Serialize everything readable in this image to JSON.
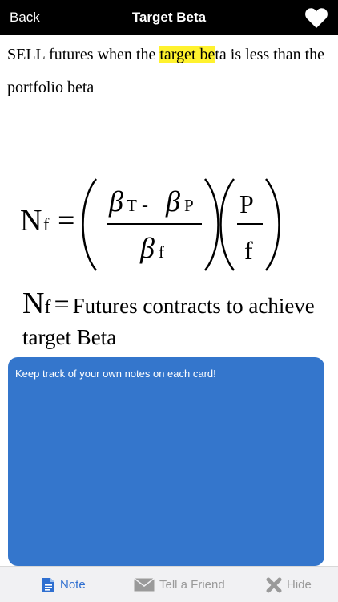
{
  "header": {
    "back_label": "Back",
    "title": "Target Beta",
    "favorite_icon": "heart-icon"
  },
  "card": {
    "text_part1": "SELL futures when the ",
    "text_highlight": "target be",
    "text_part2": "ta is less than the portfolio beta",
    "highlight_color": "#fff22e",
    "formula": {
      "lhs_main": "N",
      "lhs_sub": "f",
      "equals": "=",
      "beta": "β",
      "sub_t": "T",
      "minus": " - ",
      "sub_p": "P",
      "sub_f": "f",
      "p_upper": "P",
      "f_lower": "f"
    },
    "definition": {
      "symbol_main": "N",
      "symbol_sub": "f",
      "equals": "=",
      "text": "Futures contracts to achieve target Beta"
    }
  },
  "notes": {
    "placeholder": "Keep track of your own notes on each card!",
    "background_color": "#3476cc"
  },
  "tabbar": {
    "note_label": "Note",
    "friend_label": "Tell a Friend",
    "hide_label": "Hide",
    "active_color": "#2f6fd0",
    "inactive_color": "#9a9a9a"
  }
}
